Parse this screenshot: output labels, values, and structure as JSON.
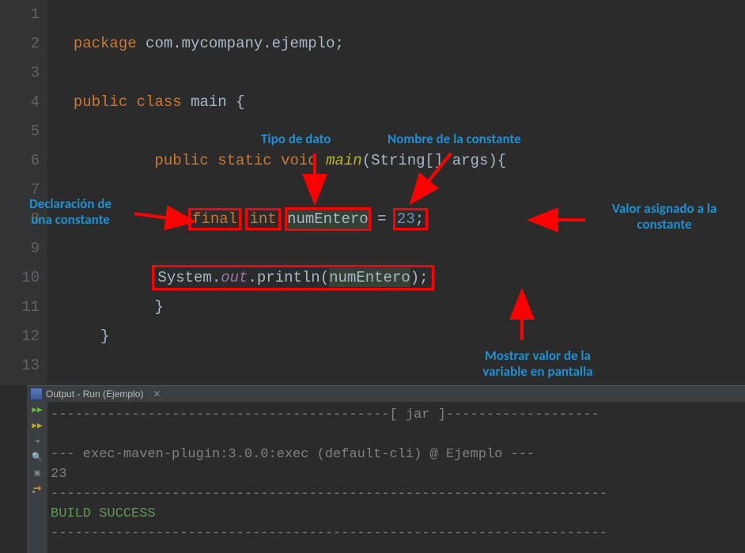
{
  "editor": {
    "lines": [
      {
        "n": "1"
      },
      {
        "n": "2"
      },
      {
        "n": "3"
      },
      {
        "n": "4"
      },
      {
        "n": "5"
      },
      {
        "n": "6"
      },
      {
        "n": "7"
      },
      {
        "n": "8"
      },
      {
        "n": "9"
      },
      {
        "n": "10"
      },
      {
        "n": "11"
      },
      {
        "n": "12"
      },
      {
        "n": "13"
      }
    ],
    "code": {
      "kw_package": "package",
      "pkg_name": "com.mycompany.ejemplo",
      "semi": ";",
      "kw_public": "public",
      "kw_class": "class",
      "class_name": "main",
      "brace_open": "{",
      "brace_close": "}",
      "kw_static": "static",
      "kw_void": "void",
      "method_name": "main",
      "paren_open": "(",
      "paren_close": ")",
      "param_type": "String[]",
      "param_name": "args",
      "kw_final": "final",
      "kw_int": "int",
      "var_name": "numEntero",
      "equals": "=",
      "val": "23",
      "sysout_class": "System",
      "dot": ".",
      "sysout_field": "out",
      "sysout_method": "println"
    }
  },
  "annotations": {
    "decl": "Declaración de\nuna constante",
    "tipo": "Tipo de dato",
    "nombre": "Nombre de la constante",
    "valor": "Valor asignado a la\nconstante",
    "mostrar": "Mostrar valor de la\nvariable en pantalla"
  },
  "output": {
    "title": "Output - Run (Ejemplo)",
    "line1": "------------------------------------------[ jar ]-------------------",
    "line2": "",
    "line3": "--- exec-maven-plugin:3.0.0:exec (default-cli) @ Ejemplo ---",
    "line4": "23",
    "line5": "---------------------------------------------------------------------",
    "line6": "BUILD SUCCESS",
    "line7": "---------------------------------------------------------------------"
  }
}
